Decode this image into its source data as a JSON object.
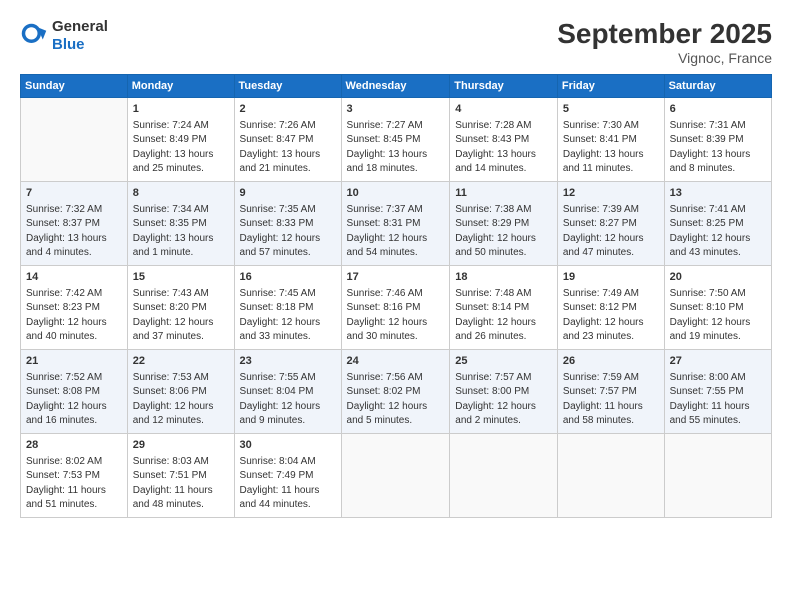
{
  "logo": {
    "general": "General",
    "blue": "Blue"
  },
  "title": "September 2025",
  "location": "Vignoc, France",
  "days_header": [
    "Sunday",
    "Monday",
    "Tuesday",
    "Wednesday",
    "Thursday",
    "Friday",
    "Saturday"
  ],
  "weeks": [
    [
      {
        "day": "",
        "info": ""
      },
      {
        "day": "1",
        "info": "Sunrise: 7:24 AM\nSunset: 8:49 PM\nDaylight: 13 hours and 25 minutes."
      },
      {
        "day": "2",
        "info": "Sunrise: 7:26 AM\nSunset: 8:47 PM\nDaylight: 13 hours and 21 minutes."
      },
      {
        "day": "3",
        "info": "Sunrise: 7:27 AM\nSunset: 8:45 PM\nDaylight: 13 hours and 18 minutes."
      },
      {
        "day": "4",
        "info": "Sunrise: 7:28 AM\nSunset: 8:43 PM\nDaylight: 13 hours and 14 minutes."
      },
      {
        "day": "5",
        "info": "Sunrise: 7:30 AM\nSunset: 8:41 PM\nDaylight: 13 hours and 11 minutes."
      },
      {
        "day": "6",
        "info": "Sunrise: 7:31 AM\nSunset: 8:39 PM\nDaylight: 13 hours and 8 minutes."
      }
    ],
    [
      {
        "day": "7",
        "info": "Sunrise: 7:32 AM\nSunset: 8:37 PM\nDaylight: 13 hours and 4 minutes."
      },
      {
        "day": "8",
        "info": "Sunrise: 7:34 AM\nSunset: 8:35 PM\nDaylight: 13 hours and 1 minute."
      },
      {
        "day": "9",
        "info": "Sunrise: 7:35 AM\nSunset: 8:33 PM\nDaylight: 12 hours and 57 minutes."
      },
      {
        "day": "10",
        "info": "Sunrise: 7:37 AM\nSunset: 8:31 PM\nDaylight: 12 hours and 54 minutes."
      },
      {
        "day": "11",
        "info": "Sunrise: 7:38 AM\nSunset: 8:29 PM\nDaylight: 12 hours and 50 minutes."
      },
      {
        "day": "12",
        "info": "Sunrise: 7:39 AM\nSunset: 8:27 PM\nDaylight: 12 hours and 47 minutes."
      },
      {
        "day": "13",
        "info": "Sunrise: 7:41 AM\nSunset: 8:25 PM\nDaylight: 12 hours and 43 minutes."
      }
    ],
    [
      {
        "day": "14",
        "info": "Sunrise: 7:42 AM\nSunset: 8:23 PM\nDaylight: 12 hours and 40 minutes."
      },
      {
        "day": "15",
        "info": "Sunrise: 7:43 AM\nSunset: 8:20 PM\nDaylight: 12 hours and 37 minutes."
      },
      {
        "day": "16",
        "info": "Sunrise: 7:45 AM\nSunset: 8:18 PM\nDaylight: 12 hours and 33 minutes."
      },
      {
        "day": "17",
        "info": "Sunrise: 7:46 AM\nSunset: 8:16 PM\nDaylight: 12 hours and 30 minutes."
      },
      {
        "day": "18",
        "info": "Sunrise: 7:48 AM\nSunset: 8:14 PM\nDaylight: 12 hours and 26 minutes."
      },
      {
        "day": "19",
        "info": "Sunrise: 7:49 AM\nSunset: 8:12 PM\nDaylight: 12 hours and 23 minutes."
      },
      {
        "day": "20",
        "info": "Sunrise: 7:50 AM\nSunset: 8:10 PM\nDaylight: 12 hours and 19 minutes."
      }
    ],
    [
      {
        "day": "21",
        "info": "Sunrise: 7:52 AM\nSunset: 8:08 PM\nDaylight: 12 hours and 16 minutes."
      },
      {
        "day": "22",
        "info": "Sunrise: 7:53 AM\nSunset: 8:06 PM\nDaylight: 12 hours and 12 minutes."
      },
      {
        "day": "23",
        "info": "Sunrise: 7:55 AM\nSunset: 8:04 PM\nDaylight: 12 hours and 9 minutes."
      },
      {
        "day": "24",
        "info": "Sunrise: 7:56 AM\nSunset: 8:02 PM\nDaylight: 12 hours and 5 minutes."
      },
      {
        "day": "25",
        "info": "Sunrise: 7:57 AM\nSunset: 8:00 PM\nDaylight: 12 hours and 2 minutes."
      },
      {
        "day": "26",
        "info": "Sunrise: 7:59 AM\nSunset: 7:57 PM\nDaylight: 11 hours and 58 minutes."
      },
      {
        "day": "27",
        "info": "Sunrise: 8:00 AM\nSunset: 7:55 PM\nDaylight: 11 hours and 55 minutes."
      }
    ],
    [
      {
        "day": "28",
        "info": "Sunrise: 8:02 AM\nSunset: 7:53 PM\nDaylight: 11 hours and 51 minutes."
      },
      {
        "day": "29",
        "info": "Sunrise: 8:03 AM\nSunset: 7:51 PM\nDaylight: 11 hours and 48 minutes."
      },
      {
        "day": "30",
        "info": "Sunrise: 8:04 AM\nSunset: 7:49 PM\nDaylight: 11 hours and 44 minutes."
      },
      {
        "day": "",
        "info": ""
      },
      {
        "day": "",
        "info": ""
      },
      {
        "day": "",
        "info": ""
      },
      {
        "day": "",
        "info": ""
      }
    ]
  ]
}
